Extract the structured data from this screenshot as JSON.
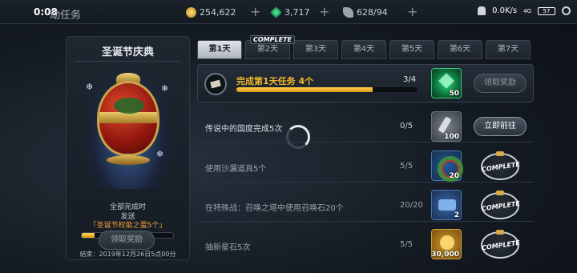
{
  "status_bar": {
    "time": "0:08",
    "net_speed": "0.0K/s",
    "signal": "4G",
    "battery": "57"
  },
  "header": {
    "title": "动任务",
    "resources": [
      {
        "name": "gold",
        "icon": "gold-coin-icon",
        "value": "254,622"
      },
      {
        "name": "gem",
        "icon": "green-gem-icon",
        "value": "3,717"
      },
      {
        "name": "stamina",
        "icon": "feather-icon",
        "value": "628/94"
      }
    ]
  },
  "event": {
    "title": "圣诞节庆典",
    "condition_line1": "全部完成时",
    "condition_line2": "发送",
    "reward_name": "「圣诞节权能之蛋5个」",
    "progress_text": "1/7",
    "progress_fraction": 0.143,
    "end_time": "结束：2019年12月26日5点00分",
    "claim_button": "领取奖励"
  },
  "tabs": {
    "complete_label": "COMPLETE",
    "items": [
      "第1天",
      "第2天",
      "第3天",
      "第4天",
      "第5天",
      "第6天",
      "第7天"
    ],
    "active_index": 0
  },
  "summary": {
    "title": "完成第1天任务  4个",
    "count": "3/4",
    "progress_fraction": 0.75,
    "reward_qty": "50",
    "claim_button": "领取奖励"
  },
  "tasks": [
    {
      "title": "传说中的国度完成5次",
      "count": "0/5",
      "reward_qty": "100",
      "reward_icon": "key-icon",
      "action": "立即前往"
    },
    {
      "title": "使用沙漏道具5个",
      "count": "5/5",
      "reward_qty": "20",
      "reward_icon": "wreath-icon",
      "stamp": "COMPLETE"
    },
    {
      "title": "在特殊战：召唤之塔中使用召唤石20个",
      "count": "20/20",
      "reward_qty": "2",
      "reward_icon": "chest-icon",
      "stamp": "COMPLETE"
    },
    {
      "title": "抽新星石5次",
      "count": "5/5",
      "reward_qty": "30,000",
      "reward_icon": "gold-pile-icon",
      "stamp": "COMPLETE"
    }
  ],
  "colors": {
    "accent": "#f0b82c",
    "progress": "#ffd04a",
    "panel": "#1e2630"
  }
}
